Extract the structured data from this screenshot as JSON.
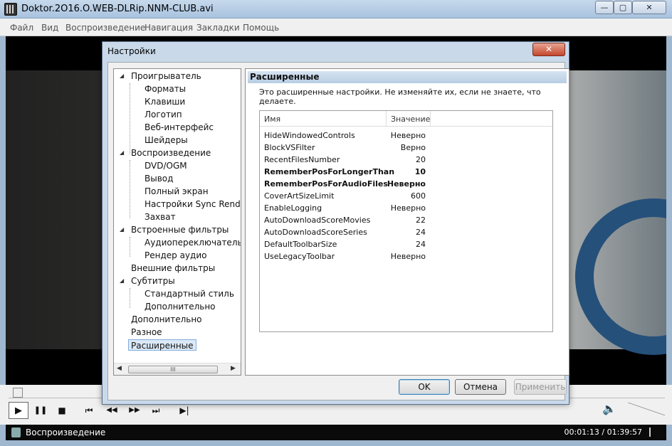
{
  "window": {
    "title": "Doktor.2O16.O.WEB-DLRip.NNM-CLUB.avi",
    "min_label": "—",
    "max_label": "▢",
    "close_label": "✕"
  },
  "menu": [
    "Файл",
    "Вид",
    "Воспроизведение",
    "Навигация",
    "Закладки",
    "Помощь"
  ],
  "dialog": {
    "title": "Настройки",
    "close_label": "✕",
    "tree": [
      {
        "label": "Проигрыватель",
        "level": 0,
        "expanded": true
      },
      {
        "label": "Форматы",
        "level": 1
      },
      {
        "label": "Клавиши",
        "level": 1
      },
      {
        "label": "Логотип",
        "level": 1
      },
      {
        "label": "Веб-интерфейс",
        "level": 1
      },
      {
        "label": "Шейдеры",
        "level": 1
      },
      {
        "label": "Воспроизведение",
        "level": 0,
        "expanded": true
      },
      {
        "label": "DVD/OGM",
        "level": 1
      },
      {
        "label": "Вывод",
        "level": 1
      },
      {
        "label": "Полный экран",
        "level": 1
      },
      {
        "label": "Настройки Sync Render",
        "level": 1
      },
      {
        "label": "Захват",
        "level": 1
      },
      {
        "label": "Встроенные фильтры",
        "level": 0,
        "expanded": true
      },
      {
        "label": "Аудиопереключатель",
        "level": 1
      },
      {
        "label": "Рендер аудио",
        "level": 1
      },
      {
        "label": "Внешние фильтры",
        "level": 0
      },
      {
        "label": "Субтитры",
        "level": 0,
        "expanded": true
      },
      {
        "label": "Стандартный стиль",
        "level": 1
      },
      {
        "label": "Дополнительно",
        "level": 1
      },
      {
        "label": "Дополнительно",
        "level": 0
      },
      {
        "label": "Разное",
        "level": 0
      },
      {
        "label": "Расширенные",
        "level": 0,
        "selected": true
      }
    ],
    "tree_scroll_label": "III",
    "panel": {
      "heading": "Расширенные",
      "description": "Это расширенные настройки. Не изменяйте их, если не знаете, что делаете.",
      "columns": {
        "name": "Имя",
        "value": "Значение"
      },
      "rows": [
        {
          "name": "HideWindowedControls",
          "value": "Неверно",
          "bold": false
        },
        {
          "name": "BlockVSFilter",
          "value": "Верно",
          "bold": false
        },
        {
          "name": "RecentFilesNumber",
          "value": "20",
          "bold": false
        },
        {
          "name": "RememberPosForLongerThan",
          "value": "10",
          "bold": true
        },
        {
          "name": "RememberPosForAudioFiles",
          "value": "Неверно",
          "bold": true
        },
        {
          "name": "CoverArtSizeLimit",
          "value": "600",
          "bold": false
        },
        {
          "name": "EnableLogging",
          "value": "Неверно",
          "bold": false
        },
        {
          "name": "AutoDownloadScoreMovies",
          "value": "22",
          "bold": false
        },
        {
          "name": "AutoDownloadScoreSeries",
          "value": "24",
          "bold": false
        },
        {
          "name": "DefaultToolbarSize",
          "value": "24",
          "bold": false
        },
        {
          "name": "UseLegacyToolbar",
          "value": "Неверно",
          "bold": false
        }
      ]
    },
    "buttons": {
      "ok": "OK",
      "cancel": "Отмена",
      "apply": "Применить"
    }
  },
  "player": {
    "controls": [
      "▶",
      "❚❚",
      "■",
      "⏮",
      "◀◀",
      "▶▶",
      "⏭",
      "▶|"
    ],
    "volume_icon": "🔈",
    "status_text": "Воспроизведение",
    "time": "00:01:13 / 01:39:57"
  }
}
